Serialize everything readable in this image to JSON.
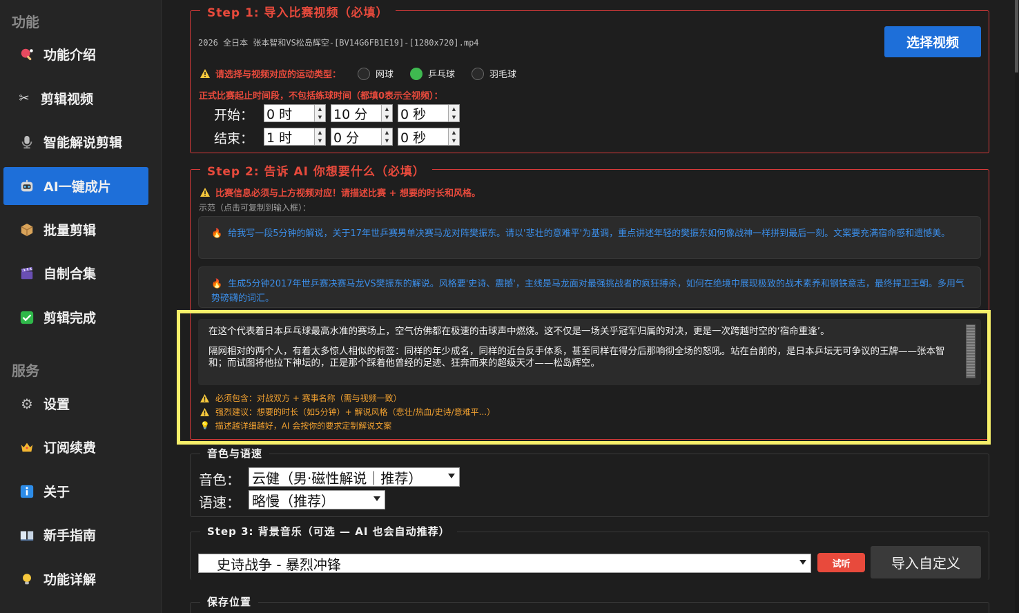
{
  "sidebar": {
    "section_features": "功能",
    "section_services": "服务",
    "items": [
      {
        "label": "功能介绍",
        "icon": "ping-pong-icon"
      },
      {
        "label": "剪辑视频",
        "icon": "scissors-icon"
      },
      {
        "label": "智能解说剪辑",
        "icon": "microphone-icon"
      },
      {
        "label": "AI一键成片",
        "icon": "robot-icon"
      },
      {
        "label": "批量剪辑",
        "icon": "package-icon"
      },
      {
        "label": "自制合集",
        "icon": "clapper-icon"
      },
      {
        "label": "剪辑完成",
        "icon": "checkmark-icon"
      }
    ],
    "service_items": [
      {
        "label": "设置",
        "icon": "gear-icon"
      },
      {
        "label": "订阅续费",
        "icon": "crown-icon"
      },
      {
        "label": "关于",
        "icon": "info-icon"
      },
      {
        "label": "新手指南",
        "icon": "book-icon"
      },
      {
        "label": "功能详解",
        "icon": "lightbulb-icon"
      }
    ],
    "active_color": "#1e6fd9"
  },
  "step1": {
    "title": "Step 1: 导入比赛视频（必填）",
    "filename": "2026 全日本 张本智和VS松岛辉空-[BV14G6FB1E19]-[1280x720].mp4",
    "select_button": "选择视频",
    "sport_prompt": "请选择与视频对应的运动类型：",
    "sports": [
      {
        "label": "网球",
        "selected": false
      },
      {
        "label": "乒乓球",
        "selected": true
      },
      {
        "label": "羽毛球",
        "selected": false
      }
    ],
    "time_note": "正式比赛起止时间段，不包括练球时间（都填0表示全视频）：",
    "start_label": "开始：",
    "end_label": "结束：",
    "start": {
      "hour": "0 时",
      "minute": "10 分",
      "second": "0 秒"
    },
    "end": {
      "hour": "1 时",
      "minute": "0 分",
      "second": "0 秒"
    }
  },
  "step2": {
    "title": "Step 2: 告诉 AI 你想要什么（必填）",
    "warning": "比赛信息必须与上方视频对应！请描述比赛 + 想要的时长和风格。",
    "example_hint": "示范（点击可复制到输入框）：",
    "examples": [
      "给我写一段5分钟的解说，关于17年世乒赛男单决赛马龙对阵樊振东。请以'悲壮的意难平'为基调，重点讲述年轻的樊振东如何像战神一样拼到最后一刻。文案要充满宿命感和遗憾美。",
      "生成5分钟2017年世乒赛决赛马龙VS樊振东的解说。风格要'史诗、震撼'，主线是马龙面对最强挑战者的疯狂搏杀，如何在绝境中展现极致的战术素养和钢铁意志，最终捍卫王朝。多用气势磅礴的词汇。"
    ],
    "input_paragraphs": [
      "在这个代表着日本乒乓球最高水准的赛场上，空气仿佛都在极速的击球声中燃烧。这不仅是一场关乎冠军归属的对决，更是一次跨越时空的‘宿命重逢’。",
      "隔网相对的两个人，有着太多惊人相似的标签：同样的年少成名，同样的近台反手体系，甚至同样在得分后那响彻全场的怒吼。站在台前的，是日本乒坛无可争议的王牌——张本智和；而试图将他拉下神坛的，正是那个踩着他曾经的足迹、狂奔而来的超级天才——松岛辉空。"
    ],
    "tips": [
      "必须包含：对战双方 + 赛事名称（需与视频一致）",
      "强烈建议：想要的时长（如5分钟）+ 解说风格（悲壮/热血/史诗/意难平...）",
      "描述越详细越好，AI 会按你的要求定制解说文案"
    ]
  },
  "voice": {
    "title": "音色与语速",
    "voice_label": "音色：",
    "voice_value": "云健（男·磁性解说｜推荐）",
    "speed_label": "语速：",
    "speed_value": "略慢（推荐）"
  },
  "step3": {
    "title": "Step 3: 背景音乐（可选 — AI 也会自动推荐）",
    "music_value": "史诗战争 - 暴烈冲锋",
    "preview_button": "试听",
    "import_button": "导入自定义"
  },
  "save": {
    "title": "保存位置"
  }
}
